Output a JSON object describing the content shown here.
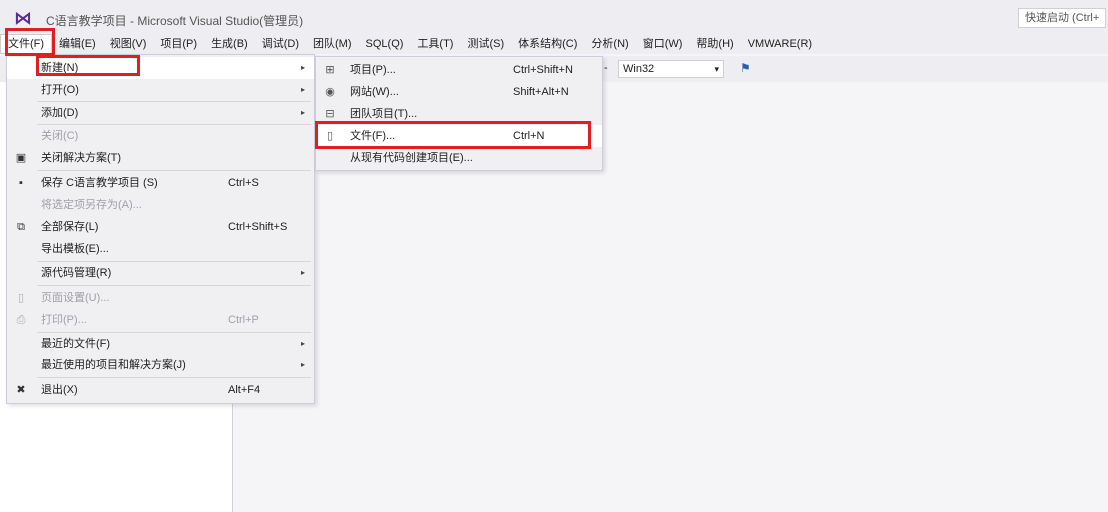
{
  "window": {
    "title": "C语言教学项目 - Microsoft Visual Studio(管理员)",
    "quick_launch_placeholder": "快速启动 (Ctrl+"
  },
  "menubar": [
    {
      "label": "文件(F)",
      "active": true
    },
    {
      "label": "编辑(E)"
    },
    {
      "label": "视图(V)"
    },
    {
      "label": "项目(P)"
    },
    {
      "label": "生成(B)"
    },
    {
      "label": "调试(D)"
    },
    {
      "label": "团队(M)"
    },
    {
      "label": "SQL(Q)"
    },
    {
      "label": "工具(T)"
    },
    {
      "label": "测试(S)"
    },
    {
      "label": "体系结构(C)"
    },
    {
      "label": "分析(N)"
    },
    {
      "label": "窗口(W)"
    },
    {
      "label": "帮助(H)"
    },
    {
      "label": "VMWARE(R)"
    }
  ],
  "toolbar": {
    "dash": "-",
    "platform": "Win32",
    "platform_arrow": "▾"
  },
  "file_menu": {
    "items": [
      {
        "label": "新建(N)",
        "submenu": true,
        "highlighted": true
      },
      {
        "label": "打开(O)",
        "submenu": true
      },
      {
        "label": "添加(D)",
        "submenu": true
      },
      {
        "label": "关闭(C)",
        "disabled": true
      },
      {
        "label": "关闭解决方案(T)",
        "icon": "solution-close-icon"
      },
      {
        "label": "保存 C语言教学项目 (S)",
        "shortcut": "Ctrl+S",
        "icon": "save-icon"
      },
      {
        "label": "将选定项另存为(A)...",
        "disabled": true
      },
      {
        "label": "全部保存(L)",
        "shortcut": "Ctrl+Shift+S",
        "icon": "save-all-icon"
      },
      {
        "label": "导出模板(E)..."
      },
      {
        "label": "源代码管理(R)",
        "submenu": true
      },
      {
        "label": "页面设置(U)...",
        "disabled": true,
        "icon": "page-setup-icon"
      },
      {
        "label": "打印(P)...",
        "shortcut": "Ctrl+P",
        "disabled": true,
        "icon": "print-icon"
      },
      {
        "label": "最近的文件(F)",
        "submenu": true
      },
      {
        "label": "最近使用的项目和解决方案(J)",
        "submenu": true
      },
      {
        "label": "退出(X)",
        "shortcut": "Alt+F4",
        "icon": "exit-icon"
      }
    ],
    "submenu_arrow": "▸"
  },
  "new_submenu": {
    "items": [
      {
        "label": "项目(P)...",
        "shortcut": "Ctrl+Shift+N",
        "icon": "project-icon"
      },
      {
        "label": "网站(W)...",
        "shortcut": "Shift+Alt+N",
        "icon": "website-icon"
      },
      {
        "label": "团队项目(T)...",
        "icon": "team-project-icon"
      },
      {
        "label": "文件(F)...",
        "shortcut": "Ctrl+N",
        "icon": "file-icon",
        "highlighted": true
      },
      {
        "label": "从现有代码创建项目(E)..."
      }
    ]
  },
  "annotations_color": "#e02020"
}
